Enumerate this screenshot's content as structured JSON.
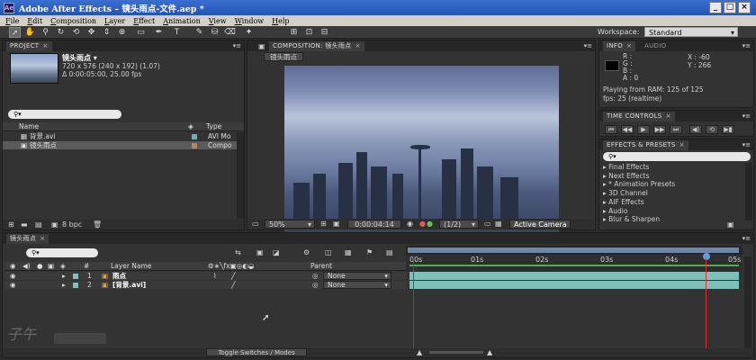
{
  "app": {
    "icon_label": "Ae",
    "title": "Adobe After Effects – 镜头雨点-文件.aep *"
  },
  "menu": [
    "File",
    "Edit",
    "Composition",
    "Layer",
    "Effect",
    "Animation",
    "View",
    "Window",
    "Help"
  ],
  "toolbar": {
    "workspace_label": "Workspace:",
    "workspace_value": "Standard"
  },
  "project": {
    "tab": "PROJECT",
    "item_name": "镜头雨点 ▾",
    "item_size": "720 x 576  (240 x 192) (1.07)",
    "item_duration": "Δ 0:00:05:00, 25.00 fps",
    "search_placeholder": "",
    "col_name": "Name",
    "col_type": "Type",
    "items": [
      {
        "name": "背景.avi",
        "type": "AVI Mo",
        "color": "#6ab0b0",
        "selected": false
      },
      {
        "name": "镜头雨点",
        "type": "Compo",
        "color": "#b38a5a",
        "selected": true
      }
    ],
    "bpc": "8 bpc"
  },
  "composition": {
    "tab": "COMPOSITION: 镜头雨点",
    "subtab": "镜头雨点",
    "zoom": "50%",
    "timecode": "0:00:04:14",
    "resolution": "(1/2)",
    "camera": "Active Camera"
  },
  "info": {
    "tab": "INFO",
    "tab2": "AUDIO",
    "r_label": "R :",
    "g_label": "G :",
    "b_label": "B :",
    "a_label": "A : 0",
    "x_label": "X : -60",
    "y_label": "Y : 266",
    "playing": "Playing from RAM: 125 of 125",
    "fps": "fps: 25 (realtime)"
  },
  "time_controls": {
    "tab": "TIME CONTROLS"
  },
  "effects": {
    "tab": "EFFECTS & PRESETS",
    "items": [
      "Final Effects",
      "Next Effects",
      "* Animation Presets",
      "3D Channel",
      "AIF Effects",
      "Audio",
      "Blur & Sharpen"
    ]
  },
  "timeline": {
    "tab": "镜头雨点",
    "col_num": "#",
    "col_layer": "Layer Name",
    "col_parent": "Parent",
    "layers": [
      {
        "num": "1",
        "name": "雨点",
        "parent": "None",
        "color": "#7fc0b8"
      },
      {
        "num": "2",
        "name": "[背景.avi]",
        "parent": "None",
        "color": "#7fc0b8"
      }
    ],
    "ruler": [
      "00s",
      "01s",
      "02s",
      "03s",
      "04s",
      "05s"
    ],
    "toggle": "Toggle Switches / Modes"
  },
  "watermark": "子午"
}
